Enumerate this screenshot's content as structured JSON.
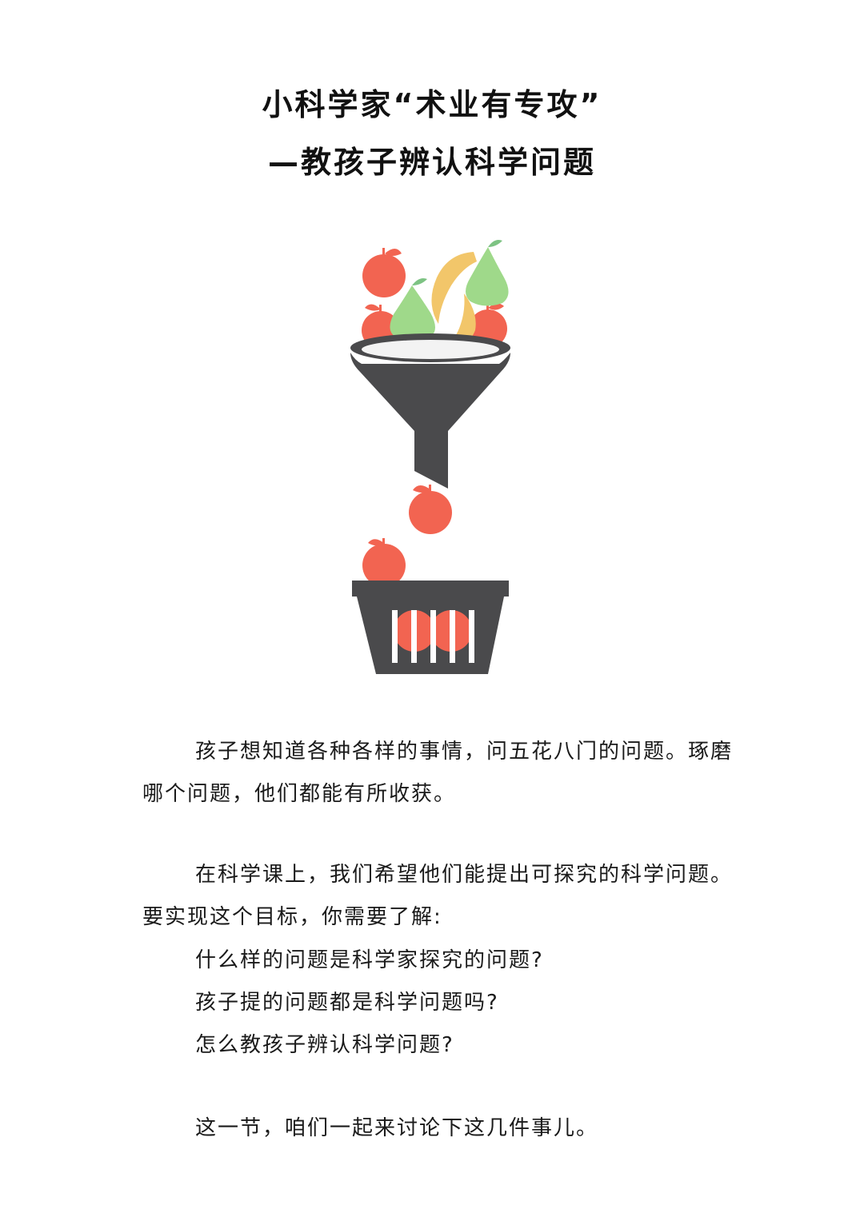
{
  "header": {
    "title_line1": "小科学家“术业有专攻”",
    "title_line2": "—教孩子辨认科学问题"
  },
  "illustration": {
    "description_icons": [
      "apple-icon",
      "pear-icon",
      "banana-icon",
      "funnel-icon",
      "basket-icon"
    ],
    "colors": {
      "apple": "#f26451",
      "leaf": "#7dc383",
      "pear": "#9fd98a",
      "banana": "#f2c66a",
      "funnel": "#4a4a4c",
      "funnel_inner": "#f3f3f3"
    }
  },
  "body": {
    "para1": "孩子想知道各种各样的事情，问五花八门的问题。琢磨哪个问题，他们都能有所收获。",
    "para2": "在科学课上，我们希望他们能提出可探究的科学问题。要实现这个目标，你需要了解:",
    "questions": [
      "什么样的问题是科学家探究的问题?",
      "孩子提的问题都是科学问题吗?",
      "怎么教孩子辨认科学问题?"
    ],
    "closing": "这一节，咱们一起来讨论下这几件事儿。"
  }
}
